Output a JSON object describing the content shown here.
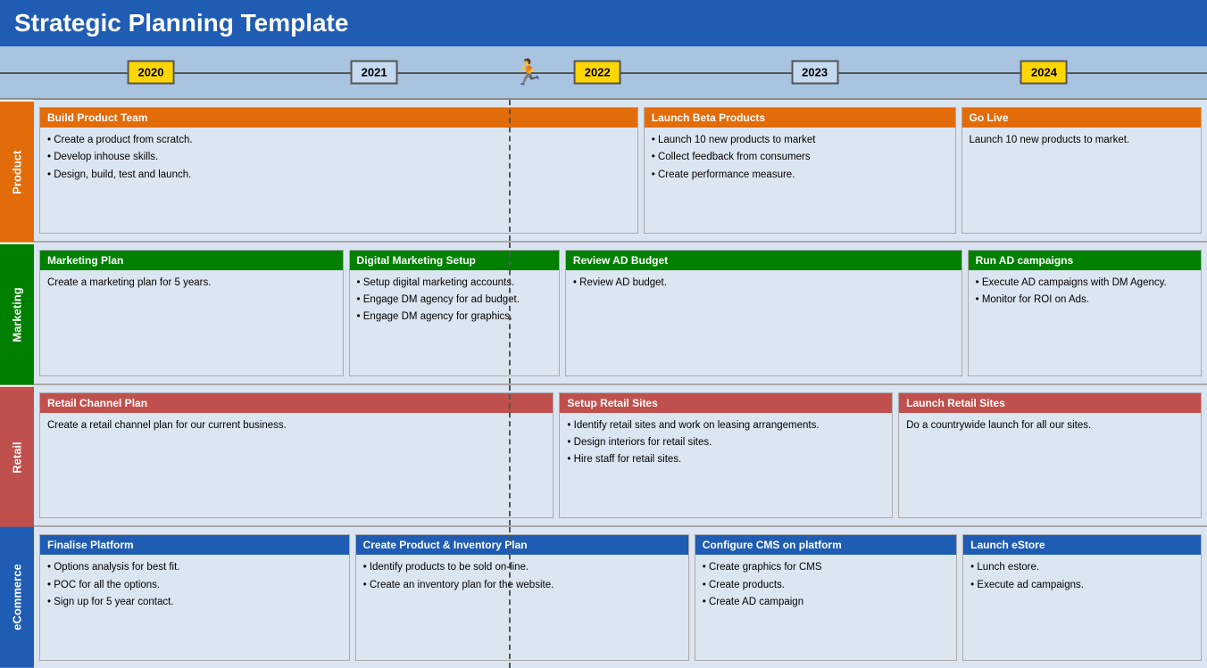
{
  "header": {
    "title": "Strategic Planning Template"
  },
  "timeline": {
    "years": [
      {
        "label": "2020",
        "style": "yellow",
        "left": "12.5%"
      },
      {
        "label": "2021",
        "style": "blue-light",
        "left": "31%"
      },
      {
        "label": "2022",
        "style": "yellow",
        "left": "49.5%"
      },
      {
        "label": "2023",
        "style": "blue-light",
        "left": "67.5%"
      },
      {
        "label": "2024",
        "style": "yellow",
        "left": "86.5%"
      }
    ],
    "runner_left": "42%"
  },
  "rows": {
    "product": {
      "label": "Product",
      "cards": [
        {
          "header": "Build Product Team",
          "header_style": "orange",
          "items": [
            "Create a product from scratch.",
            "Develop inhouse skills.",
            "Design, build, test and launch."
          ]
        },
        {
          "header": "Launch Beta Products",
          "header_style": "orange",
          "items": [
            "Launch 10 new products to market",
            "Collect feedback from consumers",
            "Create performance measure."
          ]
        },
        {
          "header": "Go Live",
          "header_style": "orange",
          "text": "Launch 10 new products to market."
        }
      ]
    },
    "marketing": {
      "label": "Marketing",
      "cards": [
        {
          "header": "Marketing Plan",
          "header_style": "green",
          "text": "Create a marketing plan for 5 years."
        },
        {
          "header": "Digital Marketing Setup",
          "header_style": "green",
          "items": [
            "Setup digital marketing accounts.",
            "Engage DM agency for ad budget.",
            "Engage DM agency for graphics."
          ]
        },
        {
          "header": "Review AD Budget",
          "header_style": "green",
          "items": [
            "Review AD budget."
          ]
        },
        {
          "header": "Run AD campaigns",
          "header_style": "green",
          "items": [
            "Execute AD campaigns with DM Agency.",
            "Monitor for ROI on Ads."
          ]
        }
      ]
    },
    "retail": {
      "label": "Retail",
      "cards": [
        {
          "header": "Retail Channel Plan",
          "header_style": "red",
          "text": "Create a retail channel plan for our current business."
        },
        {
          "header": "Setup Retail Sites",
          "header_style": "red",
          "items": [
            "Identify retail sites and work on leasing arrangements.",
            "Design interiors for retail sites.",
            "Hire staff for retail sites."
          ]
        },
        {
          "header": "Launch Retail Sites",
          "header_style": "red",
          "text": "Do a countrywide launch for all our sites."
        }
      ]
    },
    "ecommerce": {
      "label": "eCommerce",
      "cards": [
        {
          "header": "Finalise Platform",
          "header_style": "blue",
          "items": [
            "Options analysis for best fit.",
            "POC for all the options.",
            "Sign up for 5 year contact."
          ]
        },
        {
          "header": "Create Product & Inventory Plan",
          "header_style": "blue",
          "items": [
            "Identify products to be sold on-line.",
            "Create an inventory plan for the website."
          ]
        },
        {
          "header": "Configure CMS on platform",
          "header_style": "blue",
          "items": [
            "Create graphics for CMS",
            "Create products.",
            "Create AD campaign"
          ]
        },
        {
          "header": "Launch eStore",
          "header_style": "blue",
          "items": [
            "Lunch estore.",
            "Execute ad campaigns."
          ]
        }
      ]
    }
  }
}
